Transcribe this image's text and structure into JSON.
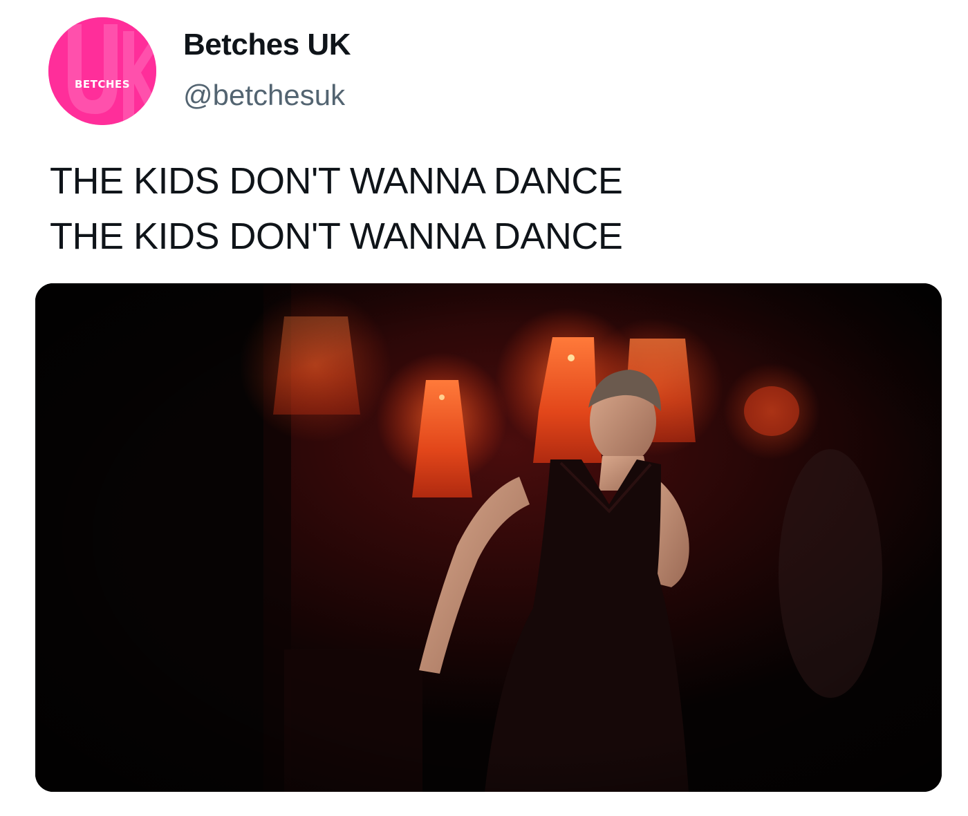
{
  "author": {
    "display_name": "Betches UK",
    "handle": "@betchesuk",
    "avatar": {
      "logo_text": "BETCHES",
      "logo_letters": "UK",
      "background_color": "#ff2e9a"
    }
  },
  "tweet": {
    "lines": [
      "THE KIDS DON'T WANNA DANCE",
      "THE KIDS DON'T WANNA DANCE"
    ]
  },
  "media": {
    "type": "video-still",
    "subject": "woman-dancing-in-dim-room-with-red-lamps"
  },
  "colors": {
    "text_primary": "#0f1419",
    "text_secondary": "#536471",
    "brand_pink": "#ff2e9a"
  }
}
